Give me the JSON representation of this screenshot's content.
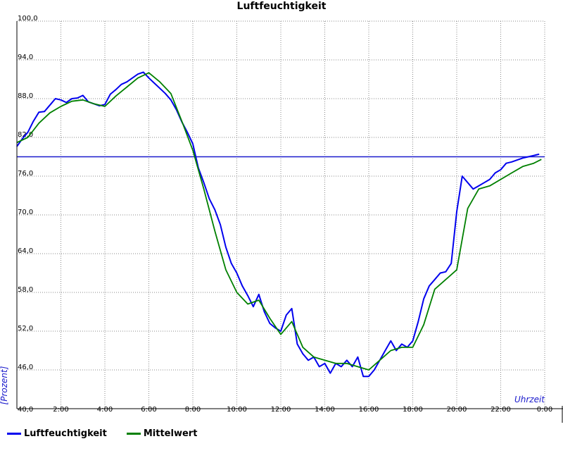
{
  "chart_data": {
    "type": "line",
    "title": "Luftfeuchtigkeit",
    "xlabel": "Uhrzeit",
    "ylabel": "[Prozent]",
    "xlim": [
      0,
      24
    ],
    "ylim": [
      40,
      100
    ],
    "y_ticks": [
      "40,0",
      "46,0",
      "52,0",
      "58,0",
      "64,0",
      "70,0",
      "76,0",
      "82,0",
      "88,0",
      "94,0",
      "100,0"
    ],
    "x_ticks": [
      "2:00",
      "4:00",
      "6:00",
      "8:00",
      "10:00",
      "12:00",
      "14:00",
      "16:00",
      "18:00",
      "20:00",
      "22:00",
      "0:00"
    ],
    "grid": true,
    "legend_position": "bottom-left",
    "reference_line": {
      "y": 79.0,
      "color": "#1a1acc"
    },
    "series": [
      {
        "name": "Luftfeuchtigkeit",
        "color": "#0000ee",
        "x": [
          0.0,
          0.25,
          0.5,
          0.75,
          1.0,
          1.25,
          1.5,
          1.75,
          2.0,
          2.25,
          2.5,
          2.75,
          3.0,
          3.25,
          3.5,
          3.75,
          4.0,
          4.25,
          4.5,
          4.75,
          5.0,
          5.25,
          5.5,
          5.75,
          6.0,
          6.25,
          6.5,
          6.75,
          7.0,
          7.25,
          7.5,
          7.75,
          8.0,
          8.25,
          8.5,
          8.75,
          9.0,
          9.25,
          9.5,
          9.75,
          10.0,
          10.25,
          10.5,
          10.75,
          11.0,
          11.25,
          11.5,
          11.75,
          12.0,
          12.25,
          12.5,
          12.75,
          13.0,
          13.25,
          13.5,
          13.75,
          14.0,
          14.25,
          14.5,
          14.75,
          15.0,
          15.25,
          15.5,
          15.75,
          16.0,
          16.25,
          16.5,
          16.75,
          17.0,
          17.25,
          17.5,
          17.75,
          18.0,
          18.25,
          18.5,
          18.75,
          19.0,
          19.25,
          19.5,
          19.75,
          20.0,
          20.25,
          20.5,
          20.75,
          21.0,
          21.25,
          21.5,
          21.75,
          22.0,
          22.25,
          22.5,
          22.75,
          23.0,
          23.25,
          23.5,
          23.75
        ],
        "values": [
          80.6,
          81.8,
          82.8,
          84.5,
          85.9,
          86.0,
          87.0,
          88.0,
          87.8,
          87.4,
          88.0,
          88.1,
          88.5,
          87.5,
          87.2,
          86.9,
          87.1,
          88.7,
          89.4,
          90.2,
          90.6,
          91.2,
          91.8,
          92.1,
          91.2,
          90.4,
          89.6,
          88.8,
          87.8,
          86.3,
          84.4,
          82.8,
          81.0,
          77.3,
          75.0,
          72.5,
          70.8,
          68.5,
          65.0,
          62.5,
          61.0,
          59.0,
          57.5,
          55.8,
          57.7,
          55.0,
          53.2,
          52.5,
          52.0,
          54.5,
          55.5,
          50.0,
          48.5,
          47.5,
          48.0,
          46.5,
          47.0,
          45.5,
          47.0,
          46.5,
          47.5,
          46.5,
          48.0,
          45.0,
          45.0,
          46.0,
          47.5,
          49.0,
          50.5,
          49.0,
          50.0,
          49.5,
          50.5,
          53.5,
          57.0,
          59.0,
          60.0,
          61.0,
          61.2,
          62.5,
          70.5,
          76.0,
          75.0,
          74.0,
          74.5,
          75.0,
          75.5,
          76.5,
          77.0,
          78.0,
          78.2,
          78.5,
          78.8,
          79.0,
          79.2,
          79.4
        ]
      },
      {
        "name": "Mittelwert",
        "color": "#008000",
        "x": [
          0.0,
          0.5,
          1.0,
          1.5,
          2.0,
          2.5,
          3.0,
          3.5,
          4.0,
          4.5,
          5.0,
          5.5,
          6.0,
          6.5,
          7.0,
          7.5,
          8.0,
          8.5,
          9.0,
          9.5,
          10.0,
          10.5,
          11.0,
          11.5,
          12.0,
          12.5,
          13.0,
          13.5,
          14.0,
          14.5,
          15.0,
          15.5,
          16.0,
          16.5,
          17.0,
          17.5,
          18.0,
          18.5,
          19.0,
          19.5,
          20.0,
          20.5,
          21.0,
          21.5,
          22.0,
          22.5,
          23.0,
          23.5,
          23.85
        ],
        "values": [
          81.2,
          82.0,
          84.2,
          85.8,
          86.8,
          87.6,
          87.8,
          87.2,
          86.8,
          88.4,
          89.8,
          91.2,
          92.0,
          90.6,
          88.8,
          84.5,
          80.0,
          74.0,
          67.5,
          61.5,
          58.0,
          56.2,
          56.8,
          54.0,
          51.5,
          53.5,
          49.5,
          48.0,
          47.5,
          47.0,
          47.0,
          46.5,
          46.0,
          47.5,
          49.0,
          49.5,
          49.5,
          53.0,
          58.5,
          60.0,
          61.5,
          71.0,
          74.0,
          74.5,
          75.5,
          76.5,
          77.5,
          78.0,
          78.6
        ]
      }
    ]
  }
}
